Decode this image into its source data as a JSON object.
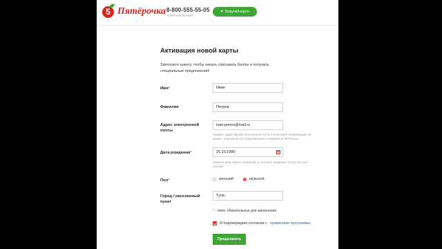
{
  "header": {
    "logo_letter": "5",
    "logo_text": "Пятёрочка",
    "phone_number": "8-800-555-55-05",
    "phone_caption": "ГОРЯЧАЯ ЛИНИЯ",
    "card_button_icon": "heart-icon",
    "card_button_label": "Выручай-карта"
  },
  "form": {
    "title": "Активация новой карты",
    "intro": "Заполните анкету, чтобы начать списывать баллы и получать специальные предложения!",
    "fields": {
      "first_name": {
        "label": "Имя",
        "required_mark": "*",
        "value": "Иван"
      },
      "last_name": {
        "label": "Фамилия",
        "value": "Петров"
      },
      "email": {
        "label": "Адрес электронной почты",
        "value": "ivan-petrov@mail.ru",
        "hint": "Укажите адрес вашей электронной почты и получайте информацию об акциях, персональных предложениях и новинках в Пятёрочке."
      },
      "birth_date": {
        "label": "Дата рождения",
        "required_mark": "*",
        "value": "25.10.1980",
        "icon": "calendar-icon",
        "hint": "Укажите день вашего рождения и получите подарок в 10 раз больше баллов!"
      },
      "gender": {
        "label": "Пол",
        "required_mark": "*",
        "options": [
          "женский",
          "мужской"
        ],
        "selected": "мужской"
      },
      "city": {
        "label": "Город / населенный пункт",
        "value": "Тула"
      }
    },
    "required_note_mark": "*",
    "required_note": "- поля, обязательные для заполнения",
    "agree_checked": true,
    "agree_text": "Я подтверждаю согласие с",
    "agree_link": "правилами программы.",
    "submit_label": "Продолжить"
  },
  "colors": {
    "brand_red": "#d9261c",
    "brand_green": "#3fa535",
    "link_blue": "#2a6fb5",
    "background": "#000000"
  }
}
